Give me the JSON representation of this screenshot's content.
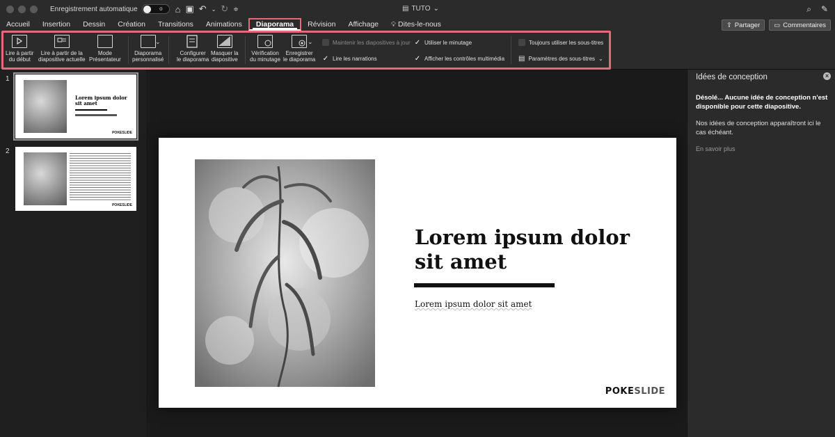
{
  "titlebar": {
    "autosave_label": "Enregistrement automatique",
    "toggle_state": "o",
    "doc_title": "TUTO"
  },
  "tabs": [
    {
      "label": "Accueil"
    },
    {
      "label": "Insertion"
    },
    {
      "label": "Dessin"
    },
    {
      "label": "Création"
    },
    {
      "label": "Transitions"
    },
    {
      "label": "Animations"
    },
    {
      "label": "Diaporama",
      "active": true
    },
    {
      "label": "Révision"
    },
    {
      "label": "Affichage"
    },
    {
      "label": "Dites-le-nous"
    }
  ],
  "share": {
    "share_label": "Partager",
    "comments_label": "Commentaires"
  },
  "ribbon": {
    "play_start": "Lire à partir\ndu début",
    "play_current": "Lire à partir de la\ndiapositive actuelle",
    "presenter": "Mode\nPrésentateur",
    "custom_show": "Diaporama\npersonnalisé",
    "setup": "Configurer\nle diaporama",
    "hide": "Masquer la\ndiapositive",
    "rehearse": "Vérification\ndu minutage",
    "record": "Enregistrer\nle diaporama",
    "keep_updated": "Maintenir les diapositives à jour",
    "play_narrations": "Lire les narrations",
    "use_timings": "Utiliser le minutage",
    "show_media": "Afficher les contrôles multimédia",
    "always_subtitles": "Toujours utiliser les sous-titres",
    "subtitle_settings": "Paramètres des sous-titres"
  },
  "thumbnails": [
    {
      "number": "1",
      "title": "Lorem ipsum dolor sit amet",
      "logo": "POKESLIDE"
    },
    {
      "number": "2",
      "logo": "POKESLIDE"
    }
  ],
  "slide": {
    "title": "Lorem ipsum dolor sit amet",
    "subtitle": "Lorem ipsum dolor sit amet",
    "logo_a": "POKE",
    "logo_b": "SLIDE"
  },
  "pane": {
    "title": "Idées de conception",
    "sorry": "Désolé... Aucune idée de conception n'est disponible pour cette diapositive.",
    "info": "Nos idées de conception apparaîtront ici le cas échéant.",
    "learn_more": "En savoir plus"
  },
  "colors": {
    "highlight": "#e66b78",
    "background": "#1f1f1f",
    "ribbon": "#2b2b2b"
  }
}
